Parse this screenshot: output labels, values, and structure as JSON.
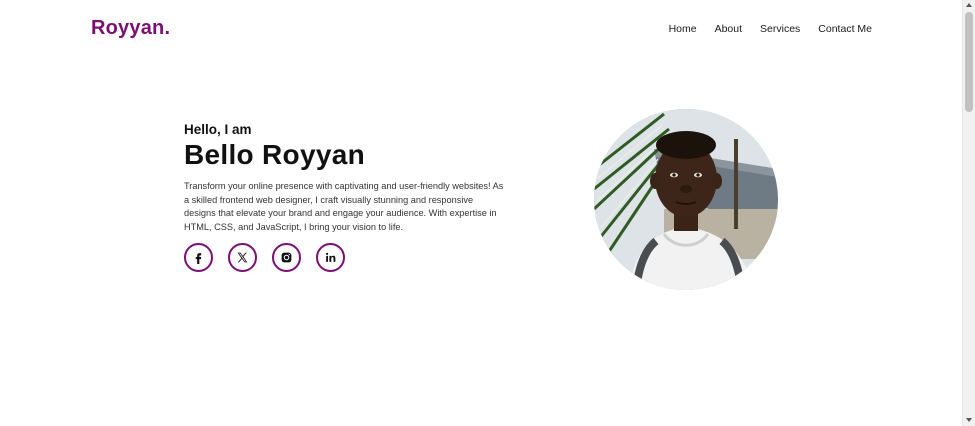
{
  "header": {
    "logo": "Royyan.",
    "nav": [
      {
        "label": "Home"
      },
      {
        "label": "About"
      },
      {
        "label": "Services"
      },
      {
        "label": "Contact Me"
      }
    ]
  },
  "hero": {
    "greeting": "Hello, I am",
    "name": "Bello Royyan",
    "description": "Transform your online presence with captivating and user-friendly websites! As a skilled frontend web designer, I craft visually stunning and responsive designs that elevate your brand and engage your audience. With expertise in HTML, CSS, and JavaScript, I bring your vision to life.",
    "socials": [
      {
        "icon": "facebook-icon"
      },
      {
        "icon": "x-icon"
      },
      {
        "icon": "instagram-icon"
      },
      {
        "icon": "linkedin-icon"
      }
    ]
  },
  "theme": {
    "accent": "#7b0f74",
    "text": "#111111",
    "background": "#ffffff"
  }
}
